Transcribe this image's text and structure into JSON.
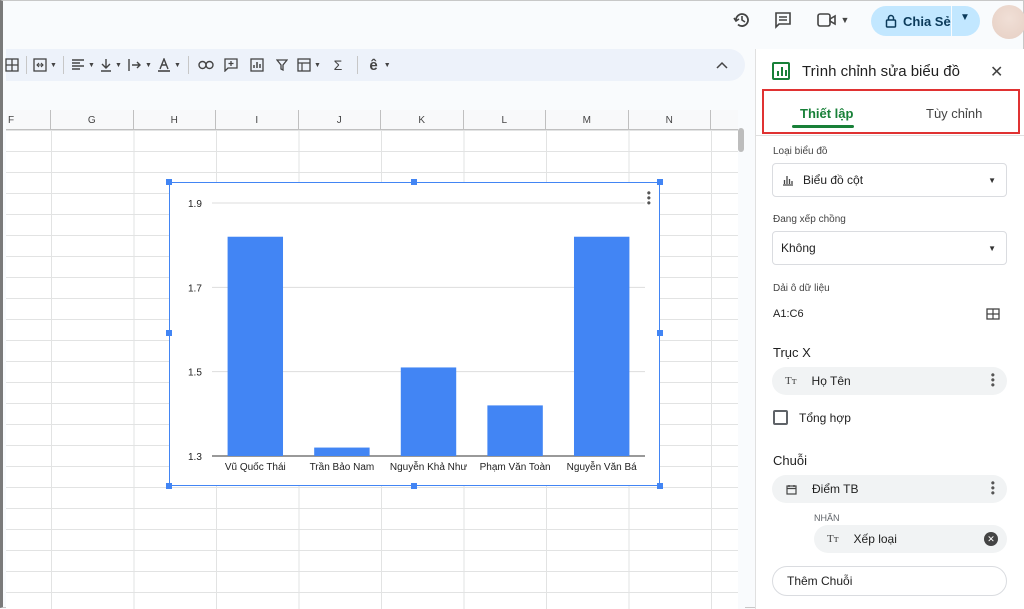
{
  "topbar": {
    "icons": [
      "history-icon",
      "comment-icon",
      "video-call-icon",
      "chevron-down-icon"
    ],
    "share_label": "Chia Sẻ"
  },
  "toolbar": {
    "icons": [
      "borders-icon",
      "merge-cells-icon",
      "align-left-icon",
      "vertical-align-icon",
      "text-wrap-icon",
      "text-color-icon",
      "link-icon",
      "comment-add-icon",
      "chart-icon",
      "filter-icon",
      "filter-views-icon",
      "functions-icon",
      "input-tools-icon",
      "collapse-icon"
    ],
    "input_tools_label": "ê"
  },
  "columns": [
    "F",
    "G",
    "H",
    "I",
    "J",
    "K",
    "L",
    "M",
    "N"
  ],
  "chart_data": {
    "type": "bar",
    "categories": [
      "Vũ Quốc Thái",
      "Trần Bảo Nam",
      "Nguyễn Khả Như",
      "Phạm Văn Toàn",
      "Nguyễn Văn Bá"
    ],
    "values": [
      1.82,
      1.32,
      1.51,
      1.42,
      1.82
    ],
    "yticks": [
      "1.3",
      "1.5",
      "1.7",
      "1.9"
    ],
    "ylim": [
      1.3,
      1.9
    ],
    "color": "#4285f4",
    "grid": true,
    "title": "",
    "xlabel": "",
    "ylabel": ""
  },
  "panel": {
    "title": "Trình chỉnh sửa biểu đồ",
    "tabs": [
      "Thiết lập",
      "Tùy chỉnh"
    ],
    "chart_type_label": "Loại biểu đồ",
    "chart_type_value": "Biểu đồ cột",
    "stacking_label": "Đang xếp chồng",
    "stacking_value": "Không",
    "range_label": "Dải ô dữ liệu",
    "range_value": "A1:C6",
    "x_axis_label": "Trục X",
    "x_axis_value": "Họ Tên",
    "aggregate_label": "Tổng hợp",
    "series_label": "Chuỗi",
    "series_value": "Điểm TB",
    "labels_heading": "NHÃN",
    "labels_value": "Xếp loại",
    "add_series": "Thêm Chuỗi",
    "type_glyph": "Tт"
  }
}
